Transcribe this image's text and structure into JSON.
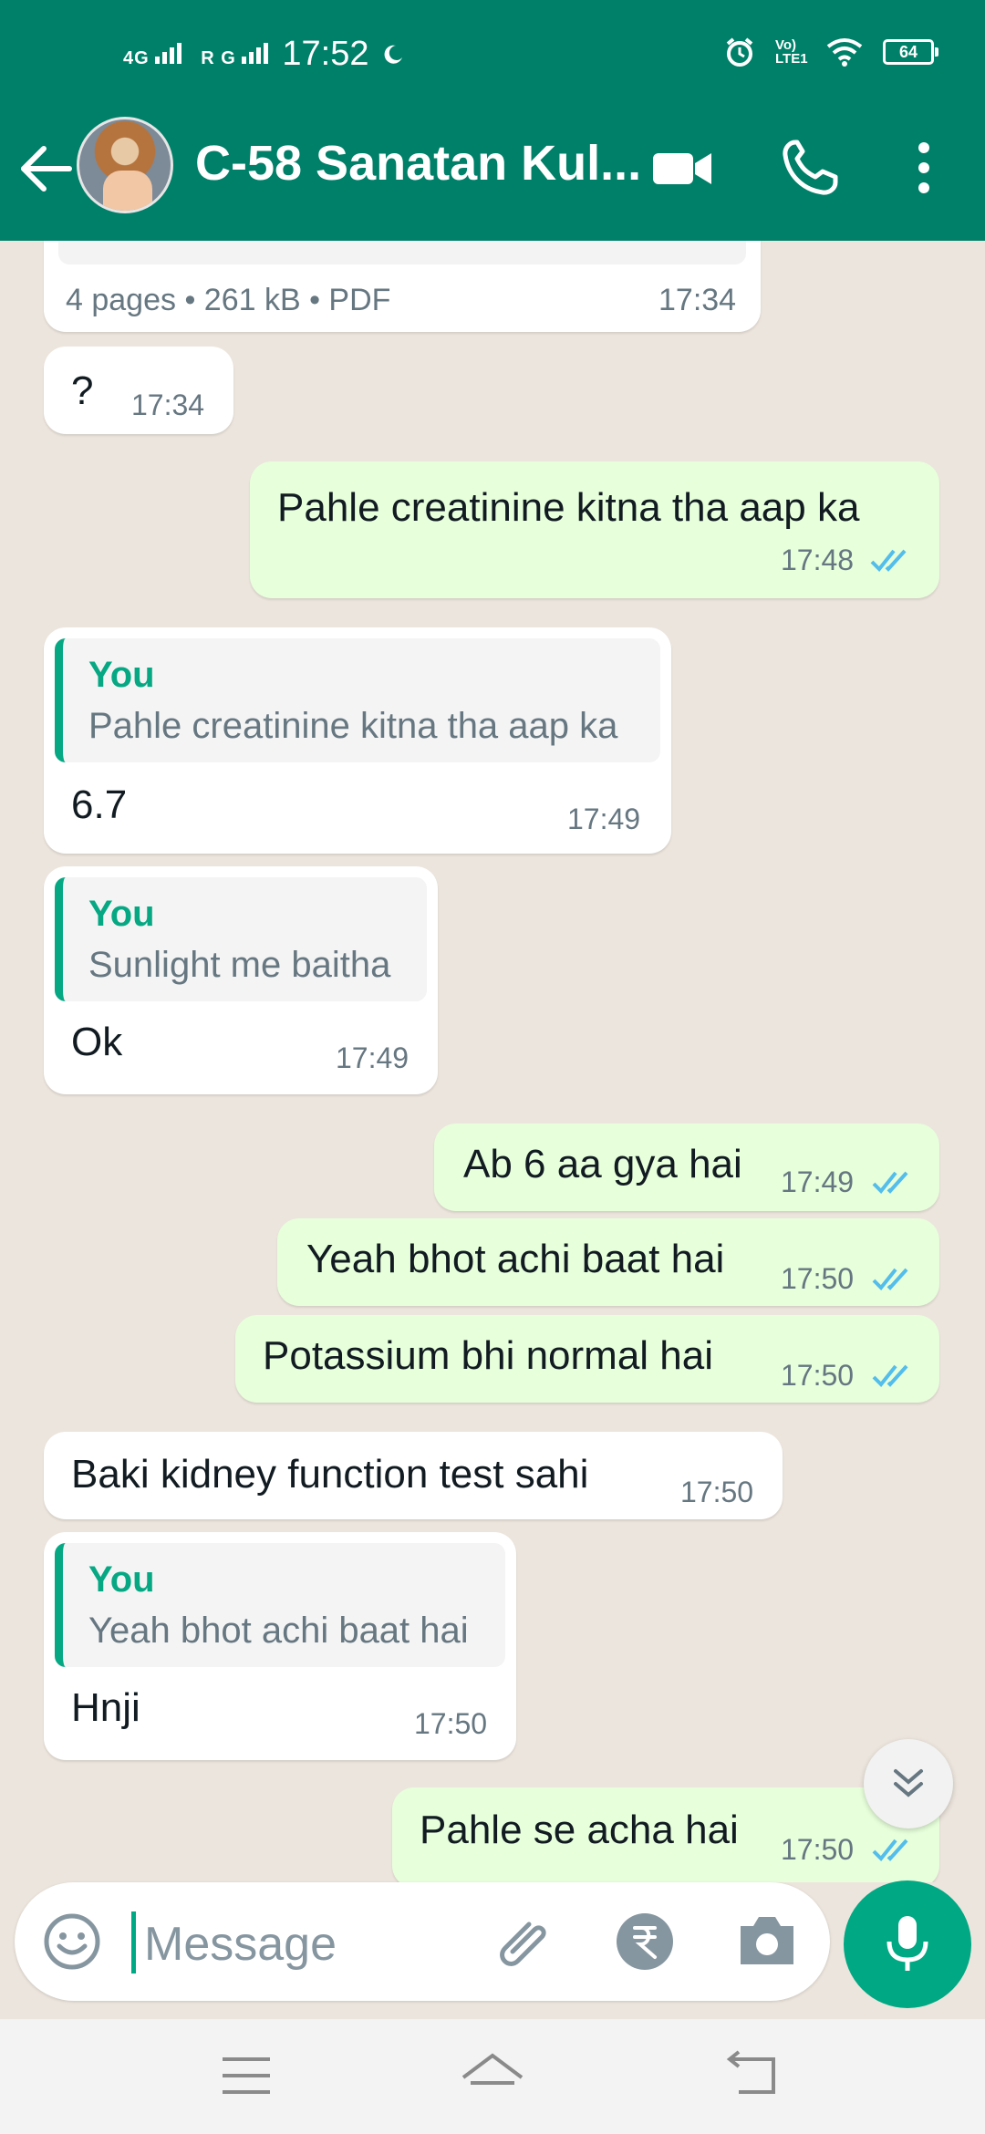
{
  "status_bar": {
    "network": "4G",
    "sim2": "R G",
    "time": "17:52",
    "volte": "Vo) LTE1",
    "battery": "64"
  },
  "header": {
    "title": "C-58 Sanatan Kul...",
    "icons": [
      "back-arrow-icon",
      "video-call-icon",
      "phone-icon",
      "more-vert-icon"
    ]
  },
  "messages": {
    "m0": {
      "meta": "4 pages • 261 kB • PDF",
      "time": "17:34"
    },
    "m1": {
      "text": "?",
      "time": "17:34"
    },
    "m2": {
      "text": "Pahle creatinine kitna tha aap ka",
      "time": "17:48"
    },
    "m3": {
      "quote_author": "You",
      "quote_text": "Pahle creatinine kitna tha aap ka",
      "text": "6.7",
      "time": "17:49"
    },
    "m4": {
      "quote_author": "You",
      "quote_text": "Sunlight me baitha",
      "text": "Ok",
      "time": "17:49"
    },
    "m5": {
      "text": "Ab 6 aa gya hai",
      "time": "17:49"
    },
    "m6": {
      "text": "Yeah bhot achi baat hai",
      "time": "17:50"
    },
    "m7": {
      "text": "Potassium bhi normal hai",
      "time": "17:50"
    },
    "m8": {
      "text": "Baki kidney function test sahi",
      "time": "17:50"
    },
    "m9": {
      "quote_author": "You",
      "quote_text": "Yeah bhot achi baat hai",
      "text": "Hnji",
      "time": "17:50"
    },
    "m10": {
      "text": "Pahle se acha hai",
      "time": "17:50"
    }
  },
  "composer": {
    "placeholder": "Message",
    "icons": [
      "emoji-icon",
      "attach-icon",
      "rupee-payment-icon",
      "camera-icon",
      "mic-icon"
    ]
  },
  "colors": {
    "header": "#008069",
    "outgoing_bubble": "#e7ffdb",
    "incoming_bubble": "#ffffff",
    "accent": "#00a884",
    "read_ticks": "#53bdeb"
  }
}
